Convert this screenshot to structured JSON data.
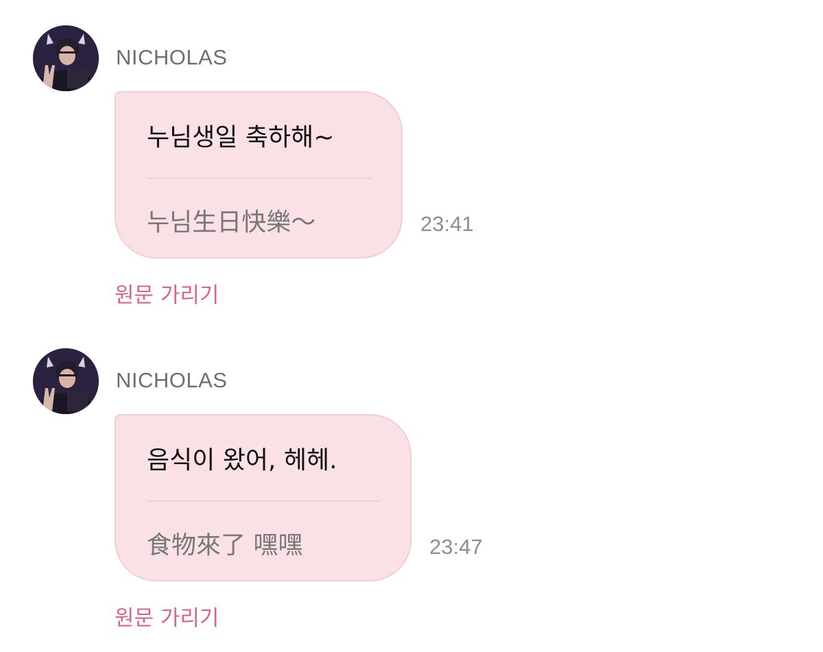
{
  "messages": [
    {
      "sender": "NICHOLAS",
      "avatar_icon": "profile-photo-avatar",
      "original_text": "누님생일 축하해~",
      "translated_text": "누님生日快樂～",
      "time": "23:41",
      "hide_original_label": "원문 가리기"
    },
    {
      "sender": "NICHOLAS",
      "avatar_icon": "profile-photo-avatar",
      "original_text": "음식이 왔어, 헤헤.",
      "translated_text": "食物來了 嘿嘿",
      "time": "23:47",
      "hide_original_label": "원문 가리기"
    }
  ],
  "colors": {
    "bubble_background": "#f9e1e6",
    "bubble_border": "#f3cdd6",
    "link_pink": "#e0608a",
    "sender_gray": "#6e6e6e",
    "time_gray": "#8e8e8e"
  }
}
